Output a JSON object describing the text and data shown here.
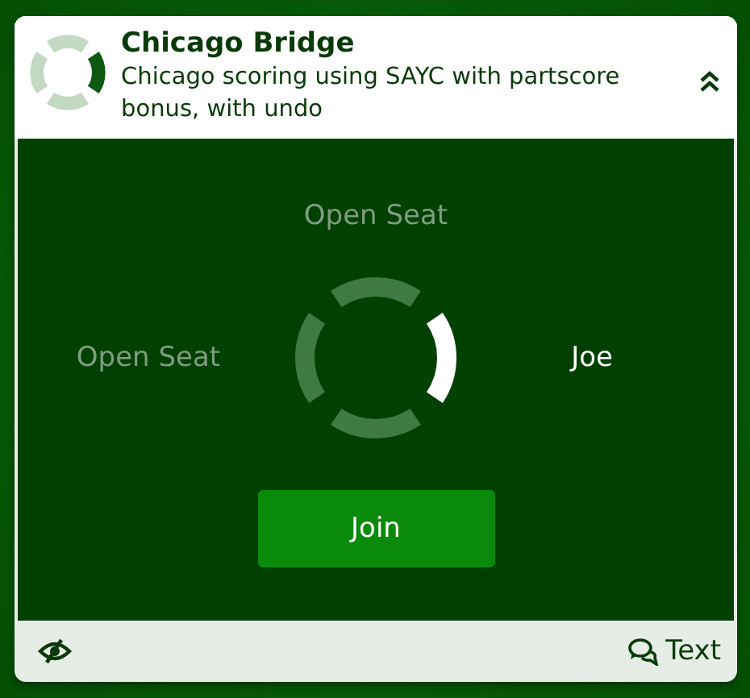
{
  "header": {
    "title": "Chicago Bridge",
    "description": "Chicago scoring using SAYC with partscore bonus, with undo",
    "expanded": true
  },
  "seats": {
    "north": {
      "label": "Open Seat",
      "occupied": false
    },
    "east": {
      "label": "Joe",
      "occupied": true
    },
    "south": {
      "occupied": false
    },
    "west": {
      "label": "Open Seat",
      "occupied": false
    }
  },
  "join_button": "Join",
  "footer": {
    "chat_label": "Text"
  }
}
